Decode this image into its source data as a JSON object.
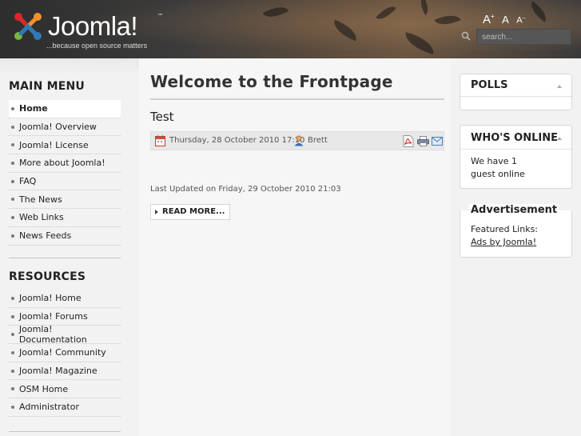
{
  "header": {
    "logo_text": "Joomla!",
    "logo_tm": "™",
    "slogan": "...because open source matters",
    "font_sizes": [
      "A",
      "A",
      "A"
    ],
    "font_size_marks": [
      "+",
      "",
      "–"
    ],
    "search_placeholder": "search...",
    "icons": [
      "joomla-logo-icon",
      "search-icon"
    ]
  },
  "left": {
    "main_menu_title": "MAIN MENU",
    "main_menu": [
      {
        "label": "Home",
        "active": true
      },
      {
        "label": "Joomla! Overview"
      },
      {
        "label": "Joomla! License"
      },
      {
        "label": "More about Joomla!"
      },
      {
        "label": "FAQ"
      },
      {
        "label": "The News"
      },
      {
        "label": "Web Links"
      },
      {
        "label": "News Feeds"
      }
    ],
    "resources_title": "RESOURCES",
    "resources": [
      {
        "label": "Joomla! Home"
      },
      {
        "label": "Joomla! Forums"
      },
      {
        "label": "Joomla! Documentation"
      },
      {
        "label": "Joomla! Community"
      },
      {
        "label": "Joomla! Magazine"
      },
      {
        "label": "OSM Home"
      },
      {
        "label": "Administrator"
      }
    ]
  },
  "main": {
    "page_title": "Welcome to the Frontpage",
    "article": {
      "title": "Test",
      "date": "Thursday, 28 October 2010 17:10",
      "author": "Brett",
      "updated": "Last Updated on Friday, 29 October 2010 21:03",
      "read_more": "READ MORE..."
    },
    "icons": [
      "calendar-icon",
      "user-icon",
      "pdf-icon",
      "print-icon",
      "email-icon"
    ]
  },
  "right": {
    "polls_title": "POLLS",
    "online_title": "WHO'S ONLINE",
    "online_line1": "We have 1",
    "online_line2": "guest online",
    "ad_title": "Advertisement",
    "ad_featured": "Featured Links:",
    "ad_link": "Ads by Joomla!"
  },
  "colors": {
    "header_dark": "#2d2d2d",
    "header_warm": "#6b5642",
    "page_bg": "#f3f3f3",
    "active_item_bg": "#ffffff",
    "logo_red": "#d8272c",
    "logo_orange": "#f39325",
    "logo_blue": "#2c79b9",
    "logo_green": "#7ab73c"
  }
}
